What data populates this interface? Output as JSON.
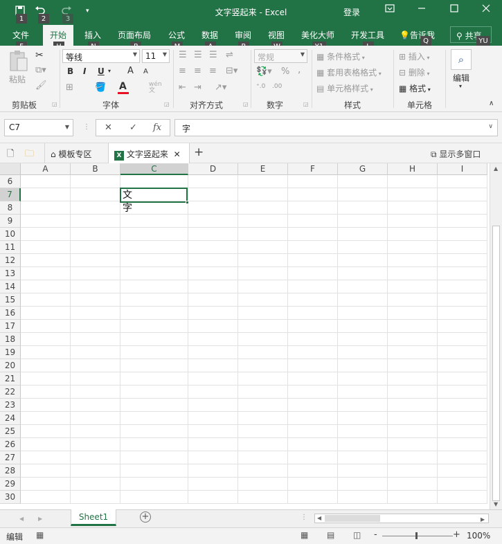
{
  "colors": {
    "brand": "#217346",
    "ribbon_bg": "#f3f3f3",
    "keytip_bg": "#4a4a4a",
    "font_color_bar": "#e81123"
  },
  "titlebar": {
    "save_icon": "save-icon",
    "undo_icon": "undo-icon",
    "redo_icon": "redo-icon",
    "customize_icon": "customize-qat-icon",
    "title": "文字竖起来  -  Excel",
    "login": "登录",
    "keytips": {
      "save": "1",
      "undo": "2",
      "redo": "3"
    }
  },
  "menu": {
    "items": [
      "文件",
      "开始",
      "插入",
      "页面布局",
      "公式",
      "数据",
      "审阅",
      "视图",
      "美化大师",
      "开发工具"
    ],
    "tell_me": "告诉我",
    "share": "共享",
    "keytips": [
      "F",
      "H",
      "N",
      "P",
      "M",
      "A",
      "R",
      "W",
      "Y1",
      "L",
      "Q",
      "YU"
    ]
  },
  "ribbon": {
    "clipboard": {
      "paste": "粘贴",
      "label": "剪贴板"
    },
    "font": {
      "name": "等线",
      "size": "11",
      "bold": "B",
      "italic": "I",
      "underline": "U",
      "grow": "A",
      "shrink": "A",
      "font_color": "A",
      "wen": "wén\n文",
      "label": "字体"
    },
    "alignment": {
      "label": "对齐方式"
    },
    "number": {
      "format": "常规",
      "percent": "%",
      "comma": ",",
      "label": "数字"
    },
    "styles": {
      "conditional": "条件格式",
      "table": "套用表格格式",
      "cell": "单元格样式",
      "label": "样式"
    },
    "cells": {
      "insert": "插入",
      "delete": "删除",
      "format": "格式",
      "label": "单元格"
    },
    "editing": {
      "label": "编辑"
    }
  },
  "formula_bar": {
    "name_box": "C7",
    "cancel": "✕",
    "enter": "✓",
    "fx": "fx",
    "content": "字"
  },
  "tabs": {
    "template": "模板专区",
    "document": "文字竖起来",
    "add": "+",
    "multi_window": "显示多窗口"
  },
  "grid": {
    "columns": [
      "A",
      "B",
      "C",
      "D",
      "E",
      "F",
      "G",
      "H",
      "I"
    ],
    "selected_column": "C",
    "rows": [
      "6",
      "7",
      "8",
      "9",
      "10",
      "11",
      "12",
      "13",
      "14",
      "15",
      "16",
      "17",
      "18",
      "19",
      "20",
      "21",
      "22",
      "23",
      "24",
      "25",
      "26",
      "27",
      "28",
      "29",
      "30"
    ],
    "selected_row": "7",
    "active_cell": {
      "ref": "C7",
      "line1": "文",
      "line2": "字"
    }
  },
  "sheets": {
    "tabs": [
      "Sheet1"
    ],
    "add": "+"
  },
  "status": {
    "mode": "编辑",
    "zoom": "100%",
    "zoom_minus": "-",
    "zoom_plus": "+"
  }
}
